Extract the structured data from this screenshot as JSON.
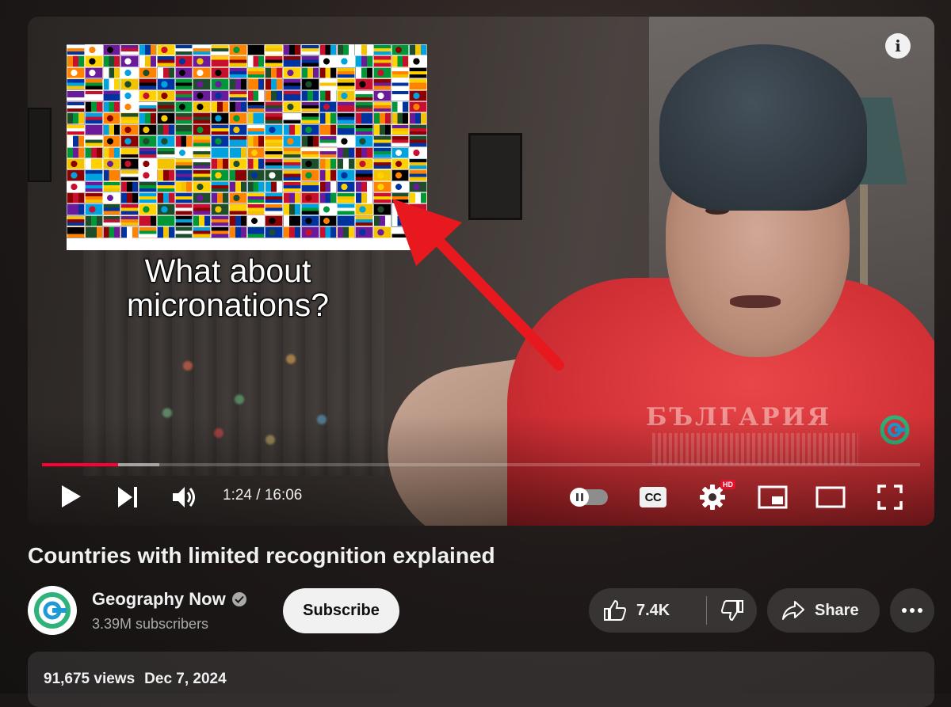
{
  "player": {
    "overlay_caption_line1": "What about",
    "overlay_caption_line2": "micronations?",
    "shirt_text": "БЪЛГАРИЯ",
    "info_icon": "i",
    "time_current": "1:24",
    "time_separator": " / ",
    "time_total": "16:06",
    "progress_played": 0.087,
    "progress_buffered": 0.134,
    "cc_label": "CC",
    "hd_badge": "HD",
    "accent_color": "#ff0033"
  },
  "video": {
    "title": "Countries with limited recognition explained"
  },
  "channel": {
    "name": "Geography Now",
    "subscribers": "3.39M subscribers",
    "subscribe_label": "Subscribe"
  },
  "actions": {
    "like_count": "7.4K",
    "share_label": "Share"
  },
  "description": {
    "views": "91,675 views",
    "date": "Dec 7, 2024"
  },
  "icons": [
    "play-icon",
    "next-icon",
    "volume-icon",
    "autoplay-toggle",
    "subtitles-icon",
    "settings-icon",
    "miniplayer-icon",
    "theater-mode-icon",
    "fullscreen-icon",
    "info-icon",
    "verified-icon",
    "like-icon",
    "dislike-icon",
    "share-icon",
    "more-icon"
  ]
}
